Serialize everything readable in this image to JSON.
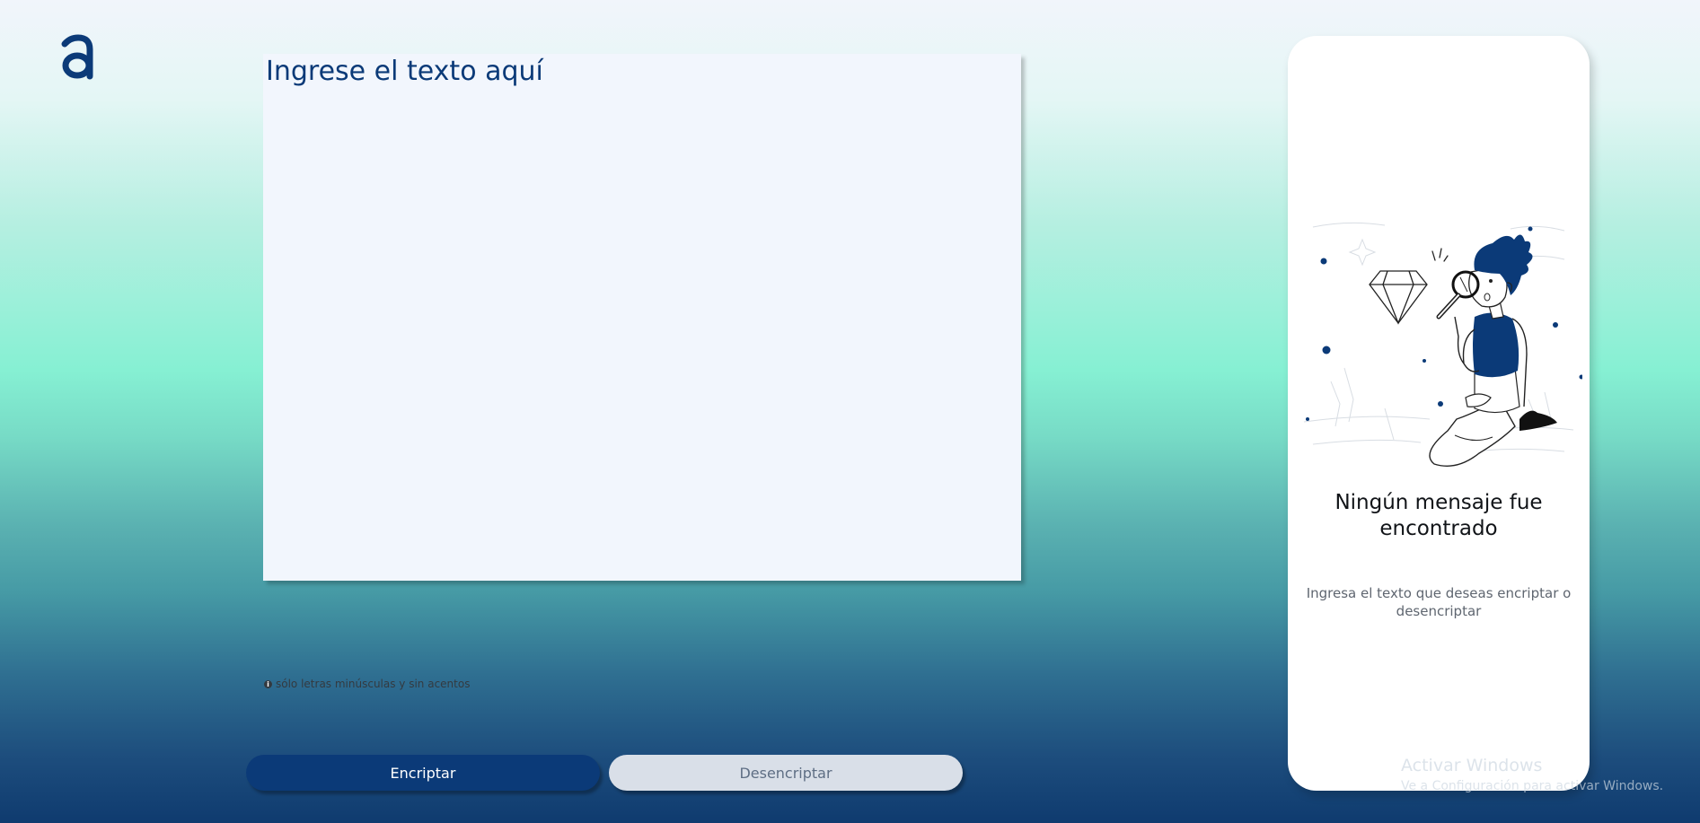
{
  "brand": {
    "logo_icon": "letter-a-logo",
    "color": "#0b3a78"
  },
  "input": {
    "placeholder": "Ingrese el texto aquí",
    "value": ""
  },
  "hint": {
    "icon": "info-circle-icon",
    "text": "sólo letras minúsculas y sin acentos"
  },
  "buttons": {
    "encrypt": "Encriptar",
    "decrypt": "Desencriptar"
  },
  "output_panel": {
    "illustration": "person-with-magnifier-illustration",
    "title": "Ningún mensaje fue encontrado",
    "subtitle": "Ingresa el texto que deseas encriptar o desencriptar"
  },
  "watermark": {
    "title": "Activar Windows",
    "subtitle": "Ve a Configuración para activar Windows."
  },
  "colors": {
    "primary": "#0b3a78",
    "secondary_button": "#d9dfe8",
    "input_bg": "#f2f6fd",
    "panel_bg": "#ffffff"
  }
}
